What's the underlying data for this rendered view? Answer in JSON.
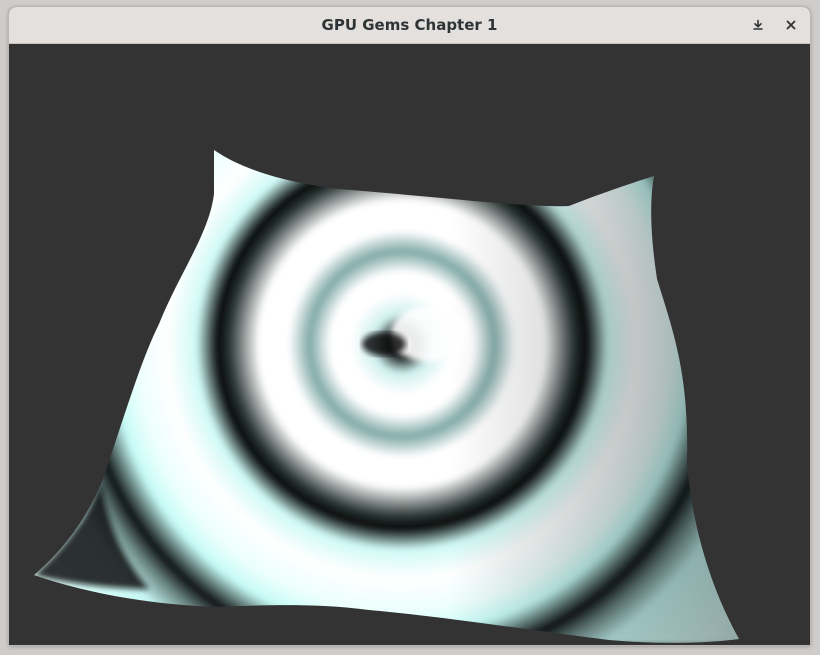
{
  "window": {
    "title": "GPU Gems Chapter 1",
    "buttons": [
      {
        "name": "minimize",
        "icon": "minimize-icon"
      },
      {
        "name": "close",
        "icon": "close-icon"
      }
    ]
  },
  "scene": {
    "background_color": "#333333",
    "surface_color": "#ccfffb",
    "content": "animated wave-displaced mesh with concentric ripples"
  }
}
